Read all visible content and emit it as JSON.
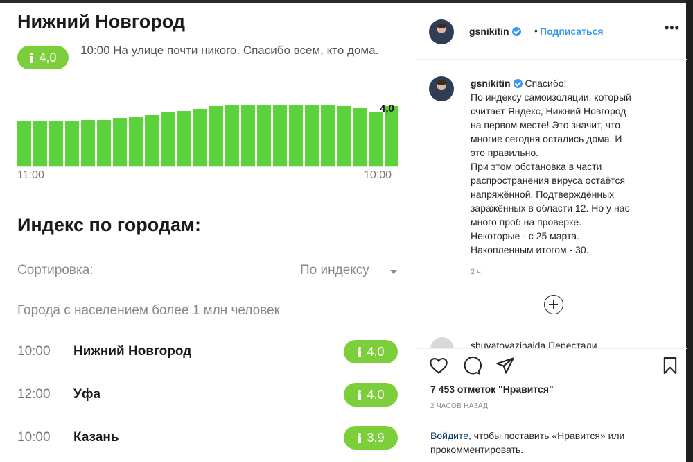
{
  "yandex": {
    "city_title": "Нижний Новгород",
    "current_index": "4,0",
    "current_note": "10:00 На улице почти никого. Спасибо всем, кто дома.",
    "chart_value_label": "4,0",
    "chart_tick_start": "11:00",
    "chart_tick_end": "10:00",
    "section_title": "Индекс по городам:",
    "sort_label": "Сортировка:",
    "sort_value": "По индексу",
    "group_label": "Города с населением более 1 млн человек",
    "rows": [
      {
        "time": "10:00",
        "city": "Нижний Новгород",
        "index": "4,0"
      },
      {
        "time": "12:00",
        "city": "Уфа",
        "index": "4,0"
      },
      {
        "time": "10:00",
        "city": "Казань",
        "index": "3,9"
      }
    ],
    "accent_color": "#7ccf3a",
    "bar_color": "#5bd23a"
  },
  "chart_data": {
    "type": "bar",
    "categories": [
      "11:00",
      "",
      "",
      "",
      "",
      "",
      "",
      "",
      "",
      "",
      "",
      "",
      "",
      "",
      "",
      "",
      "",
      "",
      "",
      "",
      "",
      "",
      "",
      "10:00"
    ],
    "values": [
      3.05,
      3.05,
      3.05,
      3.05,
      3.1,
      3.1,
      3.2,
      3.25,
      3.4,
      3.6,
      3.7,
      3.85,
      4.0,
      4.05,
      4.05,
      4.05,
      4.05,
      4.05,
      4.05,
      4.05,
      4.0,
      3.9,
      3.65,
      4.0
    ],
    "xlabel": "",
    "ylabel": "",
    "ylim": [
      0,
      4.2
    ],
    "grid": false
  },
  "instagram": {
    "username": "gsnikitin",
    "separator": "•",
    "follow_label": "Подписаться",
    "more_label": "•••",
    "caption_lines": [
      "Спасибо!",
      "По индексу самоизоляции, который",
      "считает Яндекс, Нижний Новгород",
      "на первом месте! Это значит, что",
      "многие сегодня остались дома. И",
      "это правильно.",
      "При этом обстановка в части",
      "распространения вируса остаётся",
      "напряжённой. Подтверждённых",
      "заражённых в области 12. Но у нас",
      "много проб на проверке.",
      "Некоторые - с 25 марта.",
      "Накопленным итогом - 30."
    ],
    "caption_time": "2 ч.",
    "comment_peek": "shuvatovazinaida Перестали",
    "likes": "7 453 отметок \"Нравится\"",
    "posted_ago": "2 ЧАСОВ НАЗАД",
    "login_link": "Войдите",
    "login_text": ", чтобы поставить «Нравится» или прокомментировать.",
    "link_color": "#3897f0",
    "icons": [
      "heart-icon",
      "comment-icon",
      "share-icon",
      "bookmark-icon",
      "add-comment-icon",
      "verified-icon"
    ]
  }
}
